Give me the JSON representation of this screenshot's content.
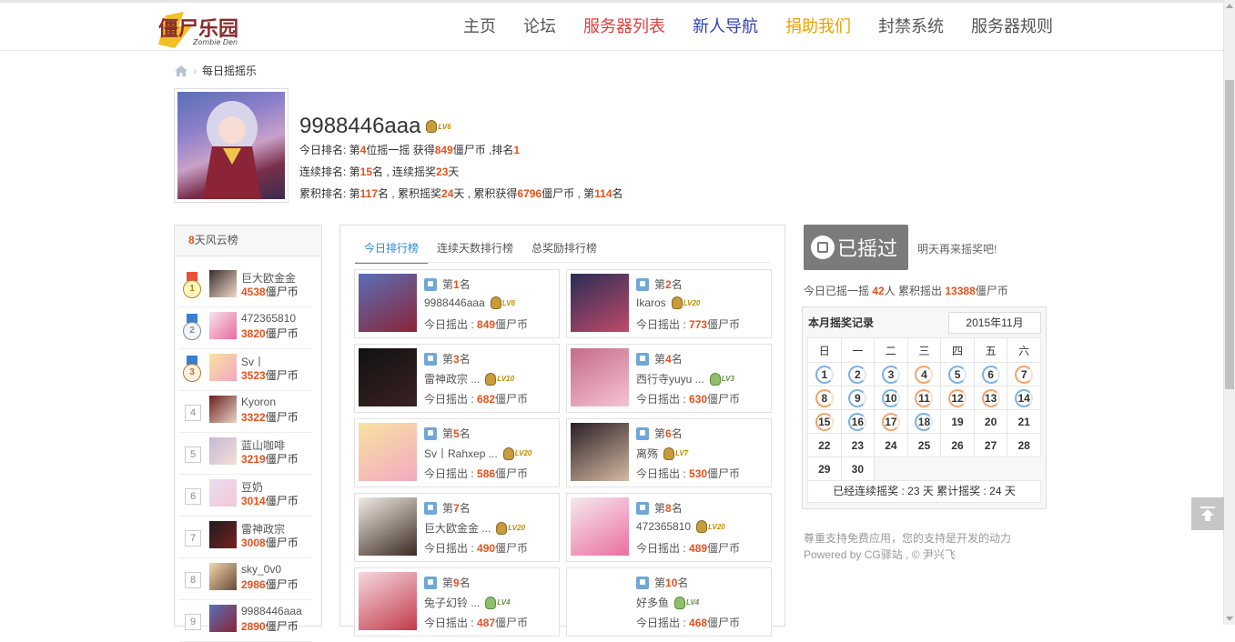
{
  "nav": {
    "logo_text": "僵尸乐园",
    "logo_sub": "Zombie Den",
    "items": [
      {
        "label": "主页",
        "color": "#555555"
      },
      {
        "label": "论坛",
        "color": "#555555"
      },
      {
        "label": "服务器列表",
        "color": "#e03c3c"
      },
      {
        "label": "新人导航",
        "color": "#2b3fb8"
      },
      {
        "label": "捐助我们",
        "color": "#f0a000"
      },
      {
        "label": "封禁系统",
        "color": "#555555"
      },
      {
        "label": "服务器规则",
        "color": "#555555"
      }
    ]
  },
  "breadcrumb": {
    "current": "每日摇摇乐"
  },
  "profile": {
    "username": "9988446aaa",
    "level": "LV6",
    "today": {
      "p1": "今日排名: 第",
      "rank": "4",
      "p2": "位摇一摇 获得",
      "coins": "849",
      "p3": "僵尸币 ,排名",
      "place": "1"
    },
    "streak": {
      "p1": "连续排名: 第",
      "rank": "15",
      "p2": "名 , 连续摇奖",
      "days": "23",
      "p3": "天"
    },
    "total": {
      "p1": "累积排名: 第",
      "rank": "117",
      "p2": "名 , 累积摇奖",
      "days": "24",
      "p3": "天 , 累积获得",
      "coins": "6796",
      "p4": "僵尸币 , 第",
      "place": "114",
      "p5": "名"
    }
  },
  "left_board": {
    "title_num": "8",
    "title_text": "天风云榜",
    "currency": "僵尸币",
    "rows": [
      {
        "rank": "1",
        "name": "巨大欧金金",
        "coins": "4538"
      },
      {
        "rank": "2",
        "name": "472365810",
        "coins": "3820"
      },
      {
        "rank": "3",
        "name": "Sv丨",
        "coins": "3523"
      },
      {
        "rank": "4",
        "name": "Kyoron",
        "coins": "3322"
      },
      {
        "rank": "5",
        "name": "蓝山咖啡",
        "coins": "3219"
      },
      {
        "rank": "6",
        "name": "豆奶",
        "coins": "3014"
      },
      {
        "rank": "7",
        "name": "雷神政宗",
        "coins": "3008"
      },
      {
        "rank": "8",
        "name": "sky_0v0",
        "coins": "2986"
      },
      {
        "rank": "9",
        "name": "9988446aaa",
        "coins": "2890"
      }
    ]
  },
  "tabs": [
    "今日排行榜",
    "连续天数排行榜",
    "总奖励排行榜"
  ],
  "cards": {
    "rank_prefix": "第",
    "rank_suffix": "名",
    "out_label": "今日摇出 : ",
    "currency": "僵尸币",
    "items": [
      {
        "rank": "1",
        "name": "9988446aaa",
        "level": "LV6",
        "coins": "849"
      },
      {
        "rank": "2",
        "name": "Ikaros",
        "level": "LV20",
        "coins": "773"
      },
      {
        "rank": "3",
        "name": "雷神政宗 ...",
        "level": "LV10",
        "coins": "682"
      },
      {
        "rank": "4",
        "name": "西行寺yuyu ...",
        "level": "LV3",
        "coins": "630"
      },
      {
        "rank": "5",
        "name": "Sv丨Rahxep ...",
        "level": "LV20",
        "coins": "586"
      },
      {
        "rank": "6",
        "name": "离殇",
        "level": "LV7",
        "coins": "530"
      },
      {
        "rank": "7",
        "name": "巨大欧金金 ...",
        "level": "LV20",
        "coins": "490"
      },
      {
        "rank": "8",
        "name": "472365810",
        "level": "LV20",
        "coins": "489"
      },
      {
        "rank": "9",
        "name": "兔子幻铃 ...",
        "level": "LV4",
        "coins": "487"
      },
      {
        "rank": "10",
        "name": "好多鱼",
        "level": "LV4",
        "coins": "468"
      }
    ]
  },
  "shake": {
    "button_label": "已摇过",
    "tomorrow": "明天再来摇奖吧!",
    "stat_p1": "今日已摇一摇 ",
    "stat_people": "42",
    "stat_p2": "人 累积摇出 ",
    "stat_coins": "13388",
    "stat_p3": "僵尸币"
  },
  "calendar": {
    "title": "本月摇奖记录",
    "month": "2015年11月",
    "weekdays": [
      "日",
      "一",
      "二",
      "三",
      "四",
      "五",
      "六"
    ],
    "footer": "已经连续摇奖 :  23 天  累计摇奖 :  24 天"
  },
  "footer": {
    "line1": "尊重支持免费应用，您的支持是开发的动力",
    "line2": "Powered by CG驿站 , © 尹兴飞"
  }
}
